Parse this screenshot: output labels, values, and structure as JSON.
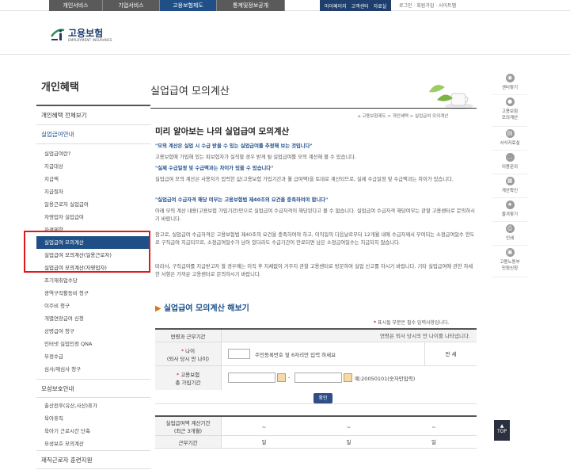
{
  "gnb": [
    "개인서비스",
    "기업서비스",
    "고용보험제도",
    "통계및정보공개"
  ],
  "util": [
    "마이페이지",
    "고객센터",
    "자료실"
  ],
  "util2": "로그인 · 회원가입 · 사이트맵",
  "logo": {
    "text": "고용보험",
    "sub": "EMPLOYMENT INSURANCE"
  },
  "lnb": {
    "title": "개인혜택",
    "head1": "개인혜택 전체보기",
    "head2": "실업급여안내",
    "items": [
      "실업급여란?",
      "지급대상",
      "지급액",
      "지급절차",
      "일용근로자 실업급여",
      "자영업자 실업급여",
      "자격제한",
      "실업급여 모의계산",
      "실업급여 모의계산(일용근로자)",
      "실업급여 모의계산(자영업자)",
      "조기재취업수당",
      "광역구직활동비 청구",
      "이주비 청구",
      "개별연장급여 신청",
      "상병급여 청구",
      "인터넷 실업인정 QNA",
      "부정수급",
      "심사/재심사 청구"
    ],
    "head3": "모성보호안내",
    "items2": [
      "출산전후(유산,사산)휴가",
      "육아휴직",
      "육아기 근로시간 단축",
      "모성보호 모의계산"
    ],
    "head4": "재직근로자 훈련지원"
  },
  "content": {
    "title": "실업급여 모의계산",
    "breadcrumb": "고용보험제도 > 개인혜택 > 실업급여 모의계산",
    "sec_title": "미리 알아보는 나의 실업급여 모의계산",
    "p1_em": "\"모의 계산은 실업 시 수급 받을 수 있는 실업급여를 추정해 보는 것입니다\"",
    "p1": "고용보험에 가입해 있는 피보험자가 실직할 경우 받게 될 실업급여를 모의 계산해 볼 수 있습니다.",
    "p2_em": "\"실제 수급일정 및 수급액과는 차이가 있을 수 있습니다\"",
    "p2": "실업급여 모의 계산은 사용자가 입력한 값(고용보험 가입기간과 월 급여액)을 토대로 계산되므로, 실제 수급일정 및 수급액과는 차이가 있습니다.",
    "p3_em": "\"실업급여 수급자격 해당 여부는 고용보험법 제40조의 요건을 충족하여야 합니다\"",
    "p3": "아래 모의 계산 내용(고용보험 가입기간)만으로 실업급여 수급자격이 해당된다고 볼 수 없습니다. 실업급여 수급자격 해당여부는 관할 고용센터로 문의하시기 바랍니다.",
    "p4": "참고로, 실업급여 수급자격은 고용보험법 제40조의 요건을 충족하여야 하고, 이직일의 다음날로부터 12개월 내에 수급자께서 부여되는 소정급여일수 한도로 구직급여 지급되므로, 소정급여일수가 남아 있더라도 수급기간이 만료되면 남은 소정급여일수는 지급되지 않습니다.",
    "p5": "따라서, 구직급여를 지급받고자 할 경우에는 이직 후 지체없이 거주지 관할 고용센터로 방문하여 실업 신고를 하시기 바랍니다. 기타 실업급여에 관한 자세한 사항은 가까운 고용센터로 문의하시기 바랍니다.",
    "sec2": "실업급여 모의계산 해보기",
    "note_star": "*",
    "note": " 표시될 부분은 필수 입력사항입니다.",
    "row_head_label": "연령과 근무기간",
    "row_head_value": "연령은 퇴사 당시의 만 나이를 나타냅니다.",
    "age_label": "나이\n(퇴사 당시 만 나이)",
    "age_hint": "주민등록번호 앞 6자리만 입력 하세요",
    "age_unit": "만  세",
    "period_label": "고용보험\n총 가입기간",
    "period_hint": "예:20050101(숫자만입력)",
    "confirm": "확인",
    "result_label": "실업급여액 계산기간\n(최근 3개월)",
    "result_vals": [
      "~",
      "~",
      "~"
    ],
    "work_label": "근무기간",
    "work_vals": [
      "일",
      "일",
      "일"
    ]
  },
  "quick": [
    "센터찾기",
    "고용보험\n모의계산",
    "서식자료실",
    "이용문의",
    "계산확인",
    "즐겨찾기",
    "인쇄",
    "고용노동부\n민원신청"
  ],
  "top": "TOP"
}
